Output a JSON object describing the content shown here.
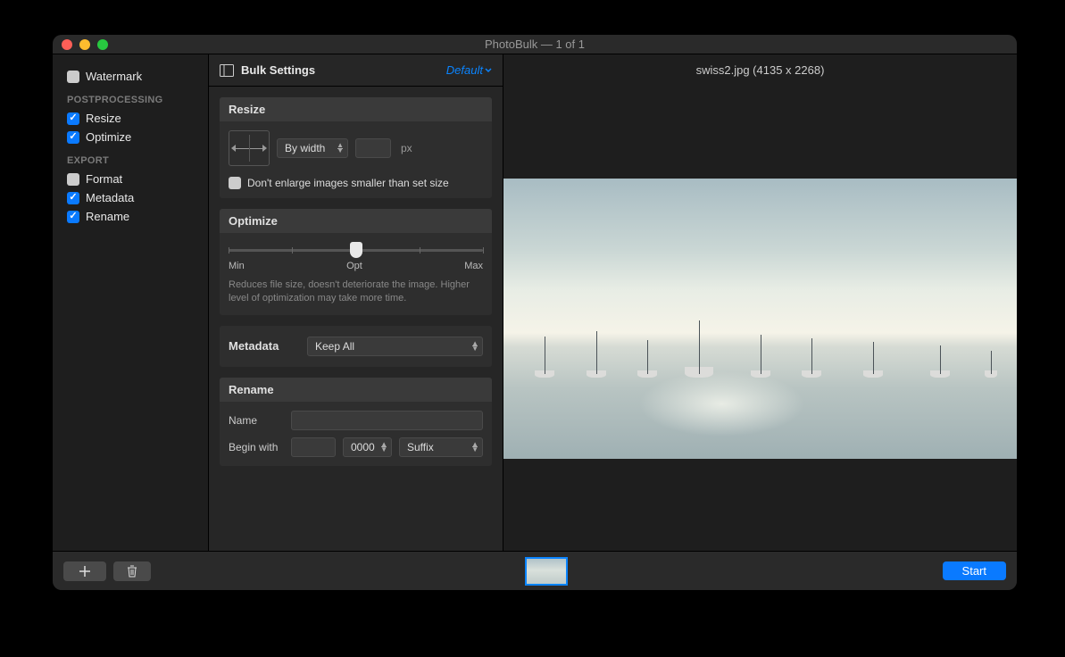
{
  "titlebar": {
    "title": "PhotoBulk — 1 of 1"
  },
  "sidebar": {
    "watermark": {
      "label": "Watermark",
      "checked": false
    },
    "section_postprocessing": "POSTPROCESSING",
    "resize": {
      "label": "Resize",
      "checked": true
    },
    "optimize": {
      "label": "Optimize",
      "checked": true
    },
    "section_export": "EXPORT",
    "format": {
      "label": "Format",
      "checked": false
    },
    "metadata": {
      "label": "Metadata",
      "checked": true
    },
    "rename": {
      "label": "Rename",
      "checked": true
    }
  },
  "settings": {
    "header_title": "Bulk Settings",
    "header_default": "Default",
    "resize": {
      "title": "Resize",
      "mode": "By width",
      "unit": "px",
      "dont_enlarge": "Don't enlarge images smaller than set size"
    },
    "optimize": {
      "title": "Optimize",
      "min": "Min",
      "opt": "Opt",
      "max": "Max",
      "desc": "Reduces file size, doesn't deteriorate the image. Higher level of optimization may take more time."
    },
    "metadata": {
      "title": "Metadata",
      "value": "Keep All"
    },
    "rename": {
      "title": "Rename",
      "name_label": "Name",
      "begin_label": "Begin with",
      "counter": "0000",
      "suffix": "Suffix"
    }
  },
  "preview": {
    "filename": "swiss2.jpg (4135 x 2268)"
  },
  "bottombar": {
    "start": "Start"
  }
}
